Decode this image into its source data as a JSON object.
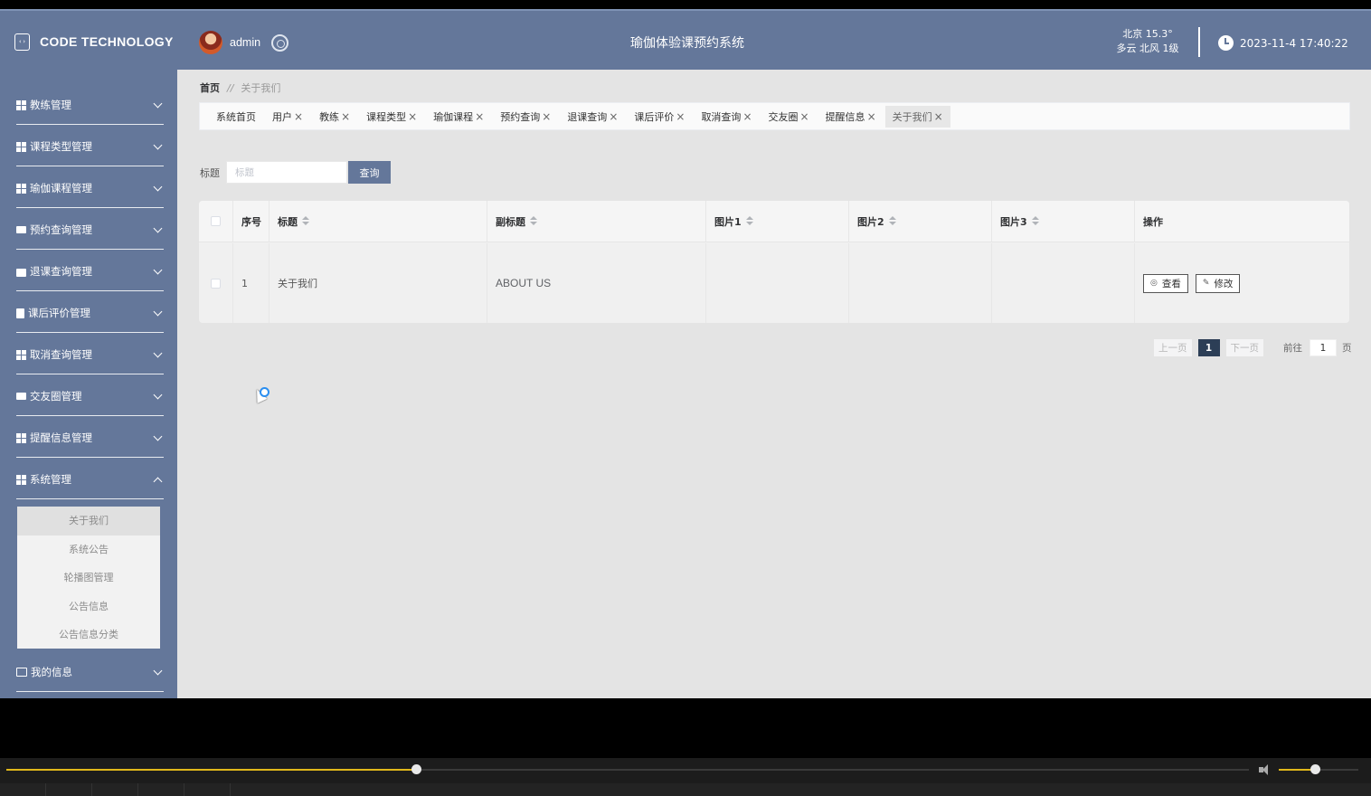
{
  "brand": {
    "name": "CODE TECHNOLOGY",
    "logo_icon": "code-file-icon"
  },
  "user": {
    "name": "admin"
  },
  "header": {
    "system_title": "瑜伽体验课预约系统",
    "weather_line1": "北京  15.3°",
    "weather_line2": "多云  北风  1级",
    "datetime": "2023-11-4 17:40:22"
  },
  "sidebar": {
    "items": [
      {
        "label": "教练管理",
        "icon": "grid-icon"
      },
      {
        "label": "课程类型管理",
        "icon": "grid-icon"
      },
      {
        "label": "瑜伽课程管理",
        "icon": "grid-icon"
      },
      {
        "label": "预约查询管理",
        "icon": "ticket-icon"
      },
      {
        "label": "退课查询管理",
        "icon": "bag-icon"
      },
      {
        "label": "课后评价管理",
        "icon": "clipboard-icon"
      },
      {
        "label": "取消查询管理",
        "icon": "grid-icon"
      },
      {
        "label": "交友圈管理",
        "icon": "monitor-icon"
      },
      {
        "label": "提醒信息管理",
        "icon": "grid-icon"
      },
      {
        "label": "系统管理",
        "icon": "grid-icon",
        "expanded": true
      },
      {
        "label": "我的信息",
        "icon": "card-icon"
      }
    ],
    "submenu": [
      "关于我们",
      "系统公告",
      "轮播图管理",
      "公告信息",
      "公告信息分类"
    ],
    "submenu_active": "关于我们"
  },
  "breadcrumb": {
    "home": "首页",
    "separator": "//",
    "current": "关于我们"
  },
  "tabs": [
    {
      "label": "系统首页",
      "closable": false
    },
    {
      "label": "用户",
      "closable": true
    },
    {
      "label": "教练",
      "closable": true
    },
    {
      "label": "课程类型",
      "closable": true
    },
    {
      "label": "瑜伽课程",
      "closable": true
    },
    {
      "label": "预约查询",
      "closable": true
    },
    {
      "label": "退课查询",
      "closable": true
    },
    {
      "label": "课后评价",
      "closable": true
    },
    {
      "label": "取消查询",
      "closable": true
    },
    {
      "label": "交友圈",
      "closable": true
    },
    {
      "label": "提醒信息",
      "closable": true
    },
    {
      "label": "关于我们",
      "closable": true,
      "active": true
    }
  ],
  "tab_close_glyph": "×",
  "search": {
    "label": "标题",
    "placeholder": "标题",
    "button": "查询"
  },
  "table": {
    "columns": [
      "序号",
      "标题",
      "副标题",
      "图片1",
      "图片2",
      "图片3",
      "操作"
    ],
    "rows": [
      {
        "index": "1",
        "title": "关于我们",
        "subtitle": "ABOUT US",
        "img1": "",
        "img2": "",
        "img3": ""
      }
    ],
    "actions": {
      "view": "查看",
      "edit": "修改"
    }
  },
  "pagination": {
    "prev": "上一页",
    "current": "1",
    "next": "下一页",
    "goto_prefix": "前往",
    "goto_value": "1",
    "goto_suffix": "页"
  },
  "player": {
    "progress": 0.33,
    "volume": 0.45
  },
  "colors": {
    "primary": "#64779a",
    "accent_yellow": "#e1b81a",
    "page_bg": "#e4e4e4"
  }
}
